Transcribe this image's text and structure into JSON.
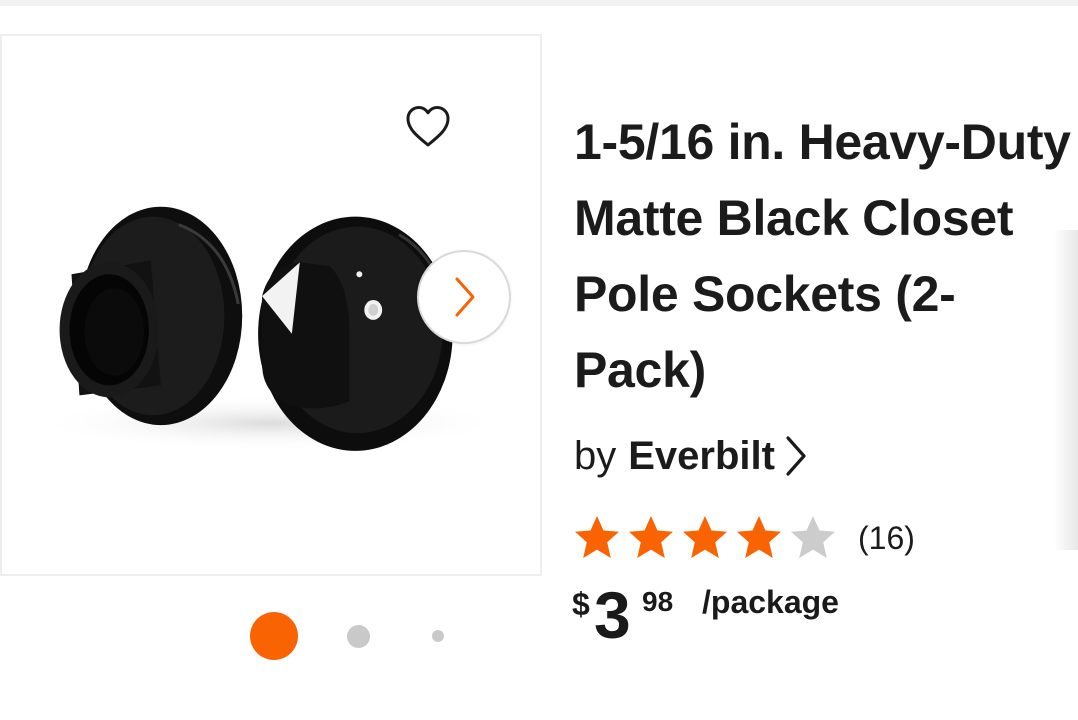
{
  "product": {
    "title": "1-5/16 in. Heavy-Duty Matte Black Closet Pole Sockets (2-Pack)",
    "brand_prefix": "by",
    "brand_name": "Everbilt",
    "rating": 4,
    "rating_max": 5,
    "review_count": "(16)",
    "price": {
      "dollar_sign": "$",
      "whole": "3",
      "cents": "98",
      "unit": "/package"
    }
  },
  "gallery": {
    "image_alt": "Matte black closet pole sockets",
    "current_slide": 1,
    "slide_count": 3
  },
  "icons": {
    "favorite": "heart-outline-icon",
    "next": "chevron-right-icon",
    "brand_link": "chevron-right-icon",
    "star": "star-icon"
  },
  "colors": {
    "accent": "#f96302",
    "star_filled": "#f96302",
    "star_empty": "#cccccc",
    "text": "#1b1b1b"
  }
}
